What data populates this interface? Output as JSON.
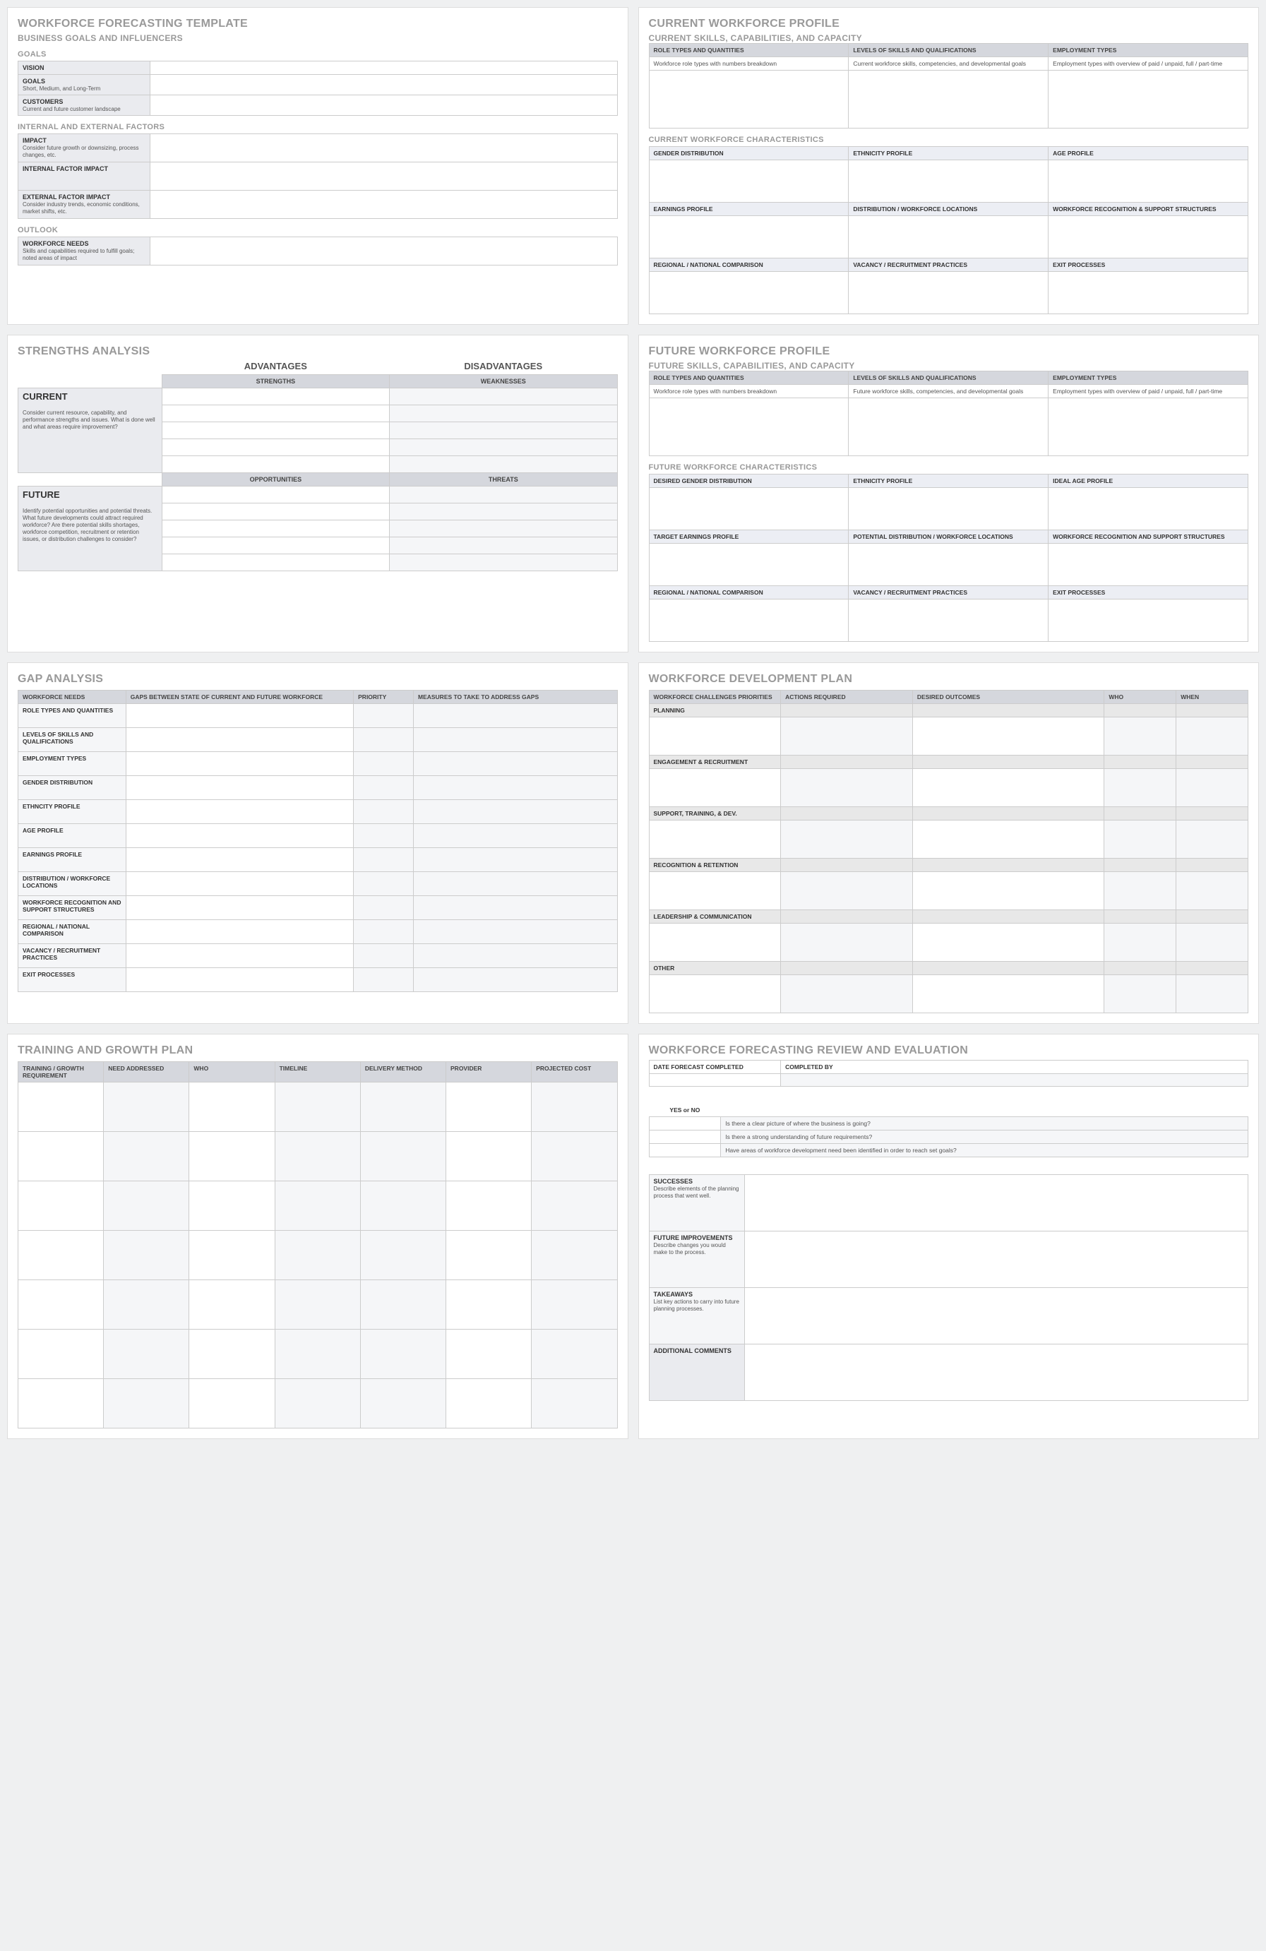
{
  "p1": {
    "title": "WORKFORCE FORECASTING TEMPLATE",
    "sub": "BUSINESS GOALS AND INFLUENCERS",
    "goals_h": "GOALS",
    "rows": [
      {
        "l": "VISION",
        "d": ""
      },
      {
        "l": "GOALS",
        "d": "Short, Medium, and Long-Term"
      },
      {
        "l": "CUSTOMERS",
        "d": "Current and future customer landscape"
      }
    ],
    "fact_h": "INTERNAL AND EXTERNAL FACTORS",
    "frows": [
      {
        "l": "IMPACT",
        "d": "Consider future growth or downsizing, process changes, etc."
      },
      {
        "l": "INTERNAL FACTOR IMPACT",
        "d": ""
      },
      {
        "l": "EXTERNAL FACTOR IMPACT",
        "d": "Consider industry trends, economic conditions, market shifts, etc."
      }
    ],
    "out_h": "OUTLOOK",
    "orows": [
      {
        "l": "WORKFORCE NEEDS",
        "d": "Skills and capabilities required to fulfill goals; noted areas of impact"
      }
    ]
  },
  "p2": {
    "title": "CURRENT WORKFORCE PROFILE",
    "sub": "CURRENT SKILLS, CAPABILITIES, AND CAPACITY",
    "h": [
      "ROLE TYPES AND QUANTITIES",
      "LEVELS OF SKILLS AND QUALIFICATIONS",
      "EMPLOYMENT TYPES"
    ],
    "r": [
      "Workforce role types with numbers breakdown",
      "Current workforce skills, competencies, and developmental goals",
      "Employment types with overview of paid / unpaid, full / part-time"
    ],
    "ch": "CURRENT WORKFORCE CHARACTERISTICS",
    "grid": [
      [
        "GENDER DISTRIBUTION",
        "ETHNICITY PROFILE",
        "AGE PROFILE"
      ],
      [
        "EARNINGS PROFILE",
        "DISTRIBUTION / WORKFORCE LOCATIONS",
        "WORKFORCE RECOGNITION & SUPPORT STRUCTURES"
      ],
      [
        "REGIONAL / NATIONAL COMPARISON",
        "VACANCY / RECRUITMENT PRACTICES",
        "EXIT PROCESSES"
      ]
    ]
  },
  "p3": {
    "title": "STRENGTHS ANALYSIS",
    "adv": "ADVANTAGES",
    "dis": "DISADVANTAGES",
    "sh": [
      "STRENGTHS",
      "WEAKNESSES"
    ],
    "cur": "CURRENT",
    "curd": "Consider current resource, capability, and performance strengths and issues.  What is done well and what areas require improvement?",
    "ot": [
      "OPPORTUNITIES",
      "THREATS"
    ],
    "fut": "FUTURE",
    "futd": "Identify potential opportunities and potential threats. What future developments could attract required workforce?  Are there potential skills shortages, workforce competition, recruitment or retention issues, or distribution challenges to consider?"
  },
  "p4": {
    "title": "FUTURE WORKFORCE PROFILE",
    "sub": "FUTURE SKILLS, CAPABILITIES, AND CAPACITY",
    "h": [
      "ROLE TYPES AND QUANTITIES",
      "LEVELS OF SKILLS AND QUALIFICATIONS",
      "EMPLOYMENT TYPES"
    ],
    "r": [
      "Workforce role types with numbers breakdown",
      "Future workforce skills, competencies, and developmental goals",
      "Employment types with overview of paid / unpaid, full / part-time"
    ],
    "ch": "FUTURE WORKFORCE CHARACTERISTICS",
    "grid": [
      [
        "DESIRED GENDER DISTRIBUTION",
        "ETHNICITY PROFILE",
        "IDEAL AGE PROFILE"
      ],
      [
        "TARGET EARNINGS PROFILE",
        "POTENTIAL DISTRIBUTION / WORKFORCE LOCATIONS",
        "WORKFORCE RECOGNITION AND SUPPORT STRUCTURES"
      ],
      [
        "REGIONAL / NATIONAL COMPARISON",
        "VACANCY / RECRUITMENT PRACTICES",
        "EXIT PROCESSES"
      ]
    ]
  },
  "p5": {
    "title": "GAP ANALYSIS",
    "h": [
      "WORKFORCE NEEDS",
      "GAPS BETWEEN STATE OF CURRENT AND FUTURE WORKFORCE",
      "PRIORITY",
      "MEASURES TO TAKE TO ADDRESS GAPS"
    ],
    "rows": [
      "ROLE TYPES AND QUANTITIES",
      "LEVELS OF SKILLS AND QUALIFICATIONS",
      "EMPLOYMENT TYPES",
      "GENDER DISTRIBUTION",
      "ETHNCITY PROFILE",
      "AGE PROFILE",
      "EARNINGS PROFILE",
      "DISTRIBUTION / WORKFORCE LOCATIONS",
      "WORKFORCE RECOGNITION AND SUPPORT STRUCTURES",
      "REGIONAL / NATIONAL COMPARISON",
      "VACANCY / RECRUITMENT PRACTICES",
      "EXIT PROCESSES"
    ]
  },
  "p6": {
    "title": "WORKFORCE DEVELOPMENT PLAN",
    "h": [
      "WORKFORCE CHALLENGES PRIORITIES",
      "ACTIONS REQUIRED",
      "DESIRED OUTCOMES",
      "WHO",
      "WHEN"
    ],
    "groups": [
      "PLANNING",
      "ENGAGEMENT & RECRUITMENT",
      "SUPPORT, TRAINING, & DEV.",
      "RECOGNITION & RETENTION",
      "LEADERSHIP & COMMUNICATION",
      "OTHER"
    ]
  },
  "p7": {
    "title": "TRAINING AND GROWTH PLAN",
    "h": [
      "TRAINING / GROWTH REQUIREMENT",
      "NEED ADDRESSED",
      "WHO",
      "TIMELINE",
      "DELIVERY METHOD",
      "PROVIDER",
      "PROJECTED COST"
    ]
  },
  "p8": {
    "title": "WORKFORCE FORECASTING REVIEW AND EVALUATION",
    "h": [
      "DATE FORECAST COMPLETED",
      "COMPLETED BY"
    ],
    "yn": "YES or NO",
    "q": [
      "Is there a clear picture of where the business is going?",
      "Is there a strong understanding of future requirements?",
      "Have areas of workforce development need been identified in order to reach set goals?"
    ],
    "rows": [
      {
        "l": "SUCCESSES",
        "d": "Describe elements of the planning process that went well."
      },
      {
        "l": "FUTURE IMPROVEMENTS",
        "d": "Describe changes you would make to the process."
      },
      {
        "l": "TAKEAWAYS",
        "d": "List key actions to carry into future planning processes."
      },
      {
        "l": "ADDITIONAL COMMENTS",
        "d": ""
      }
    ]
  }
}
